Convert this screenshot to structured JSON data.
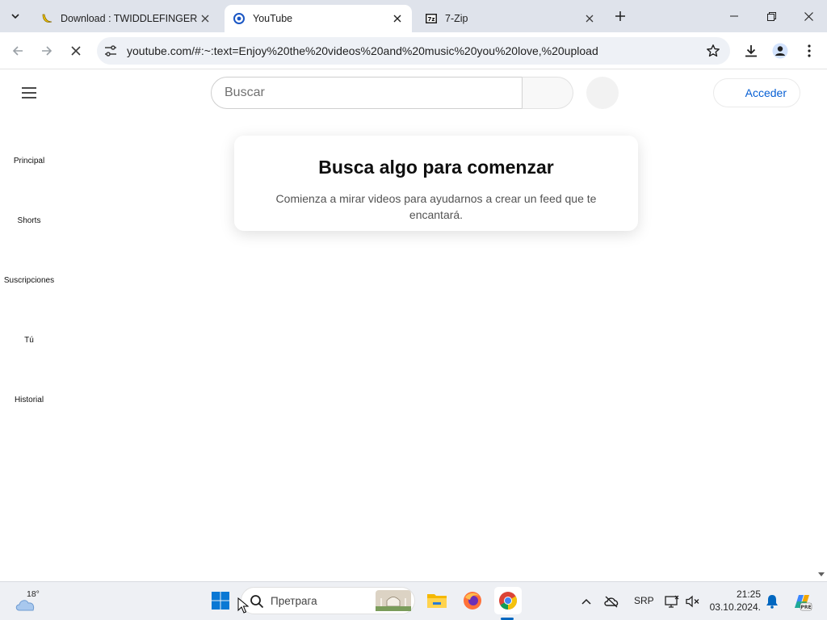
{
  "browser": {
    "tabs": [
      {
        "title": "Download : TWIDDLEFINGER (C",
        "icon": "banana-icon",
        "active": false
      },
      {
        "title": "YouTube",
        "icon": "youtube-loading-icon",
        "active": true
      },
      {
        "title": "7-Zip",
        "icon": "7zip-icon",
        "active": false
      }
    ],
    "url": "youtube.com/#:~:text=Enjoy%20the%20videos%20and%20music%20you%20love,%20upload"
  },
  "youtube": {
    "search_placeholder": "Buscar",
    "signin_label": "Acceder",
    "sidebar": [
      {
        "label": "Principal"
      },
      {
        "label": "Shorts"
      },
      {
        "label": "Suscripciones"
      },
      {
        "label": "Tú"
      },
      {
        "label": "Historial"
      }
    ],
    "empty_state": {
      "title": "Busca algo para comenzar",
      "message": "Comienza a mirar videos para ayudarnos a crear un feed que te encantará."
    }
  },
  "taskbar": {
    "weather_temp": "18°",
    "search_label": "Претрага",
    "language": "SRP",
    "time": "21:25",
    "date": "03.10.2024."
  },
  "colors": {
    "tabstrip_bg": "#dfe3eb",
    "link_blue": "#065fd4",
    "taskbar_bg": "#eef0f4"
  }
}
